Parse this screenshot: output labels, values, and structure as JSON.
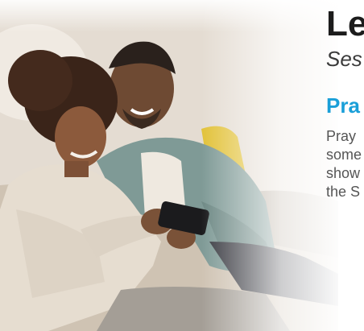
{
  "header": {
    "title": "Le",
    "subtitle": "Ses"
  },
  "section": {
    "title": "Pra",
    "body_lines": [
      "Pray",
      "some",
      "show",
      "the S"
    ]
  },
  "photo": {
    "icon": "photo-couple-with-phone"
  },
  "colors": {
    "accent": "#1a9fd8",
    "title": "#1c1c1c",
    "body": "#555555"
  }
}
